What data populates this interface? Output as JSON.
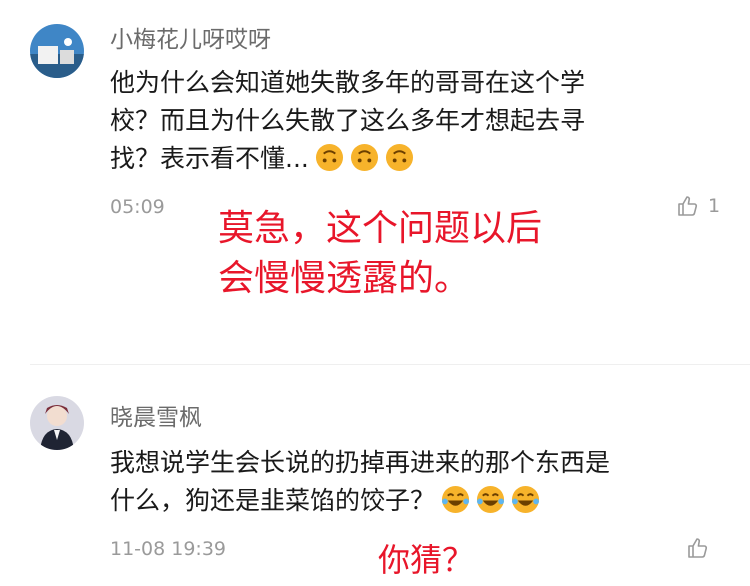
{
  "comments": [
    {
      "username": "小梅花儿呀哎呀",
      "text_lines": [
        "他为什么会知道她失散多年的哥哥在这个学",
        "校？而且为什么失散了这么多年才想起去寻",
        "找？表示看不懂..."
      ],
      "time": "05:09",
      "likes": "1",
      "reply_lines": [
        "莫急，这个问题以后",
        "会慢慢透露的。"
      ],
      "emoji": "upside-down-face"
    },
    {
      "username": "晓晨雪枫",
      "text_lines": [
        "我想说学生会长说的扔掉再进来的那个东西是",
        "什么，狗还是韭菜馅的饺子？"
      ],
      "time": "11-08 19:39",
      "likes": "",
      "reply_lines": [
        "你猜？"
      ],
      "emoji": "tears-of-joy-face"
    }
  ],
  "colors": {
    "handwriting": "#e8162a",
    "emoji": "#f7b32b"
  }
}
